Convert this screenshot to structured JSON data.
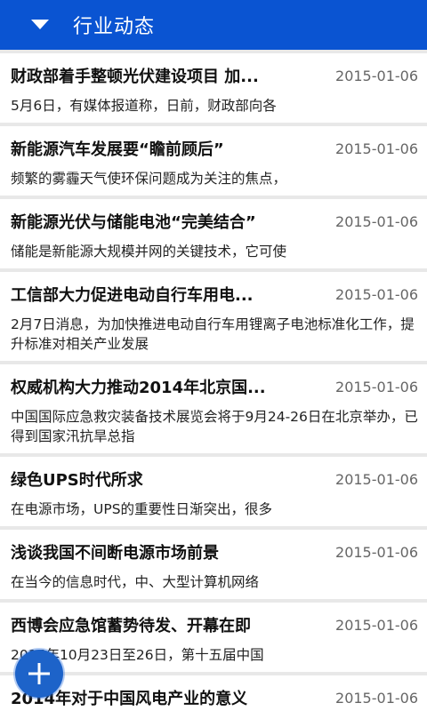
{
  "header": {
    "title": "行业动态",
    "toggle_icon": "triangle-down-icon"
  },
  "colors": {
    "header_bg": "#0a54d2",
    "fab_bg": "#1d63c9"
  },
  "news": [
    {
      "title": "财政部着手整顿光伏建设项目 加...",
      "date": "2015-01-06",
      "summary": "5月6日，有媒体报道称，日前，财政部向各"
    },
    {
      "title": "新能源汽车发展要“瞻前顾后”",
      "date": "2015-01-06",
      "summary": "频繁的雾霾天气使环保问题成为关注的焦点，"
    },
    {
      "title": "新能源光伏与储能电池“完美结合”",
      "date": "2015-01-06",
      "summary": "储能是新能源大规模并网的关键技术，它可使"
    },
    {
      "title": "工信部大力促进电动自行车用电...",
      "date": "2015-01-06",
      "summary": "2月7日消息，为加快推进电动自行车用锂离子电池标准化工作，提升标准对相关产业发展"
    },
    {
      "title": "权威机构大力推动2014年北京国...",
      "date": "2015-01-06",
      "summary": "中国国际应急救灾装备技术展览会将于9月24-26日在北京举办，已得到国家汛抗旱总指"
    },
    {
      "title": "绿色UPS时代所求",
      "date": "2015-01-06",
      "summary": "在电源市场，UPS的重要性日渐突出，很多"
    },
    {
      "title": "浅谈我国不间断电源市场前景",
      "date": "2015-01-06",
      "summary": "在当今的信息时代，中、大型计算机网络"
    },
    {
      "title": "西博会应急馆蓄势待发、开幕在即",
      "date": "2015-01-06",
      "summary": "2015年10月23日至26日，第十五届中国"
    },
    {
      "title": "2014年对于中国风电产业的意义",
      "date": "2015-01-06",
      "summary": ""
    }
  ],
  "fab": {
    "icon": "plus-icon"
  }
}
